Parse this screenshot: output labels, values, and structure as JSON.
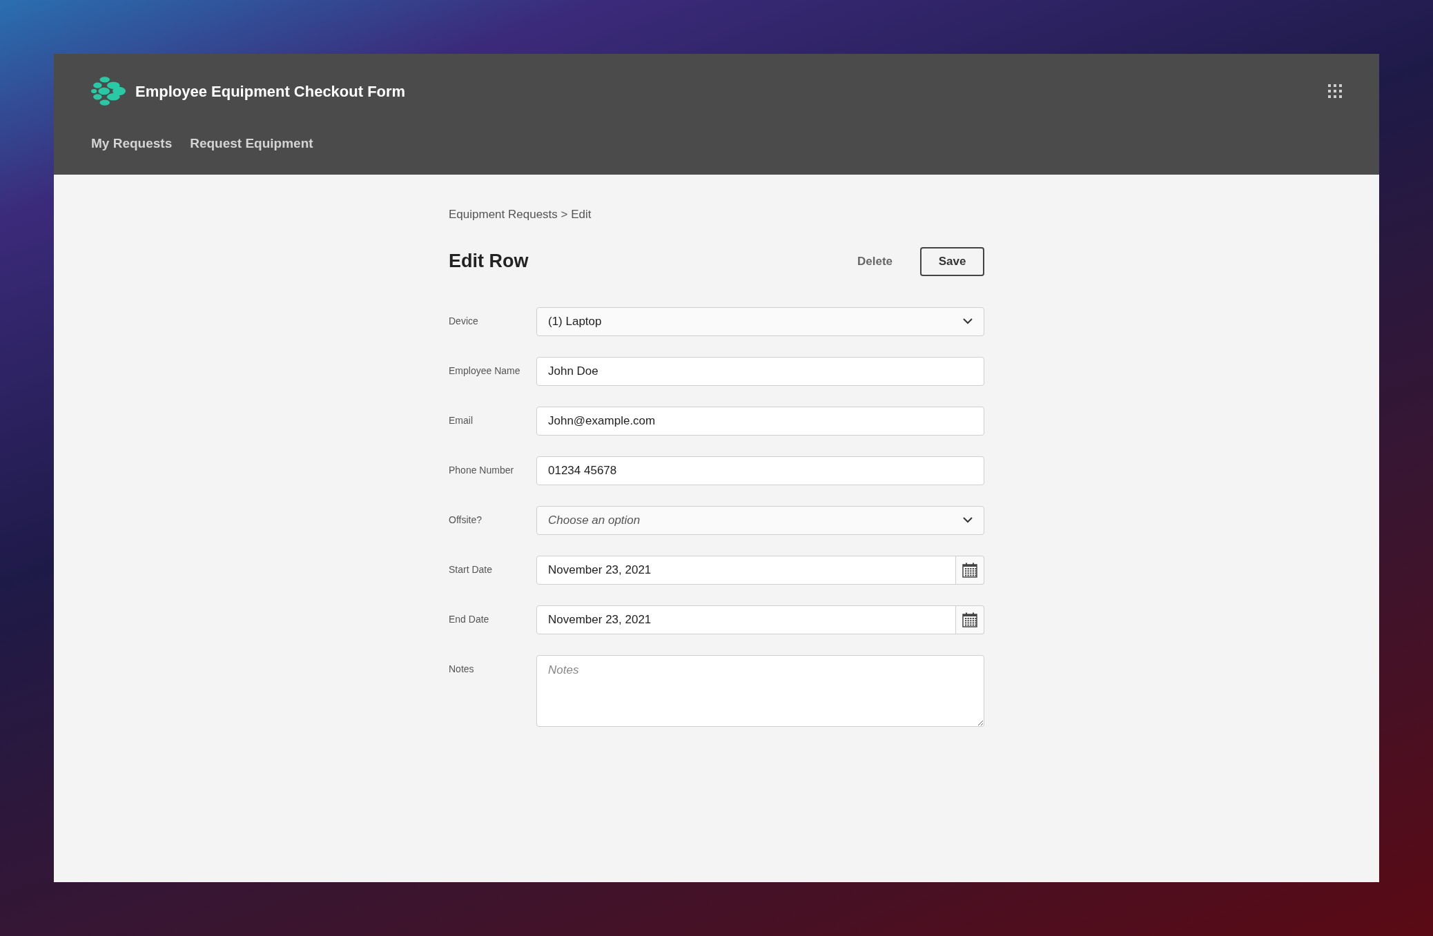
{
  "app": {
    "title": "Employee Equipment Checkout Form"
  },
  "nav": [
    {
      "label": "My Requests"
    },
    {
      "label": "Request Equipment"
    }
  ],
  "breadcrumb": "Equipment Requests > Edit",
  "heading": "Edit Row",
  "actions": {
    "delete": "Delete",
    "save": "Save"
  },
  "fields": [
    {
      "kind": "select",
      "label": "Device",
      "value": "(1) Laptop"
    },
    {
      "kind": "text",
      "label": "Employee Name",
      "value": "John Doe"
    },
    {
      "kind": "text",
      "label": "Email",
      "value": "John@example.com"
    },
    {
      "kind": "text",
      "label": "Phone Number",
      "value": "01234 45678"
    },
    {
      "kind": "select",
      "label": "Offsite?",
      "placeholder": "Choose an option"
    },
    {
      "kind": "date",
      "label": "Start Date",
      "value": "November 23, 2021"
    },
    {
      "kind": "date",
      "label": "End Date",
      "value": "November 23, 2021"
    },
    {
      "kind": "textarea",
      "label": "Notes",
      "placeholder": "Notes"
    }
  ]
}
